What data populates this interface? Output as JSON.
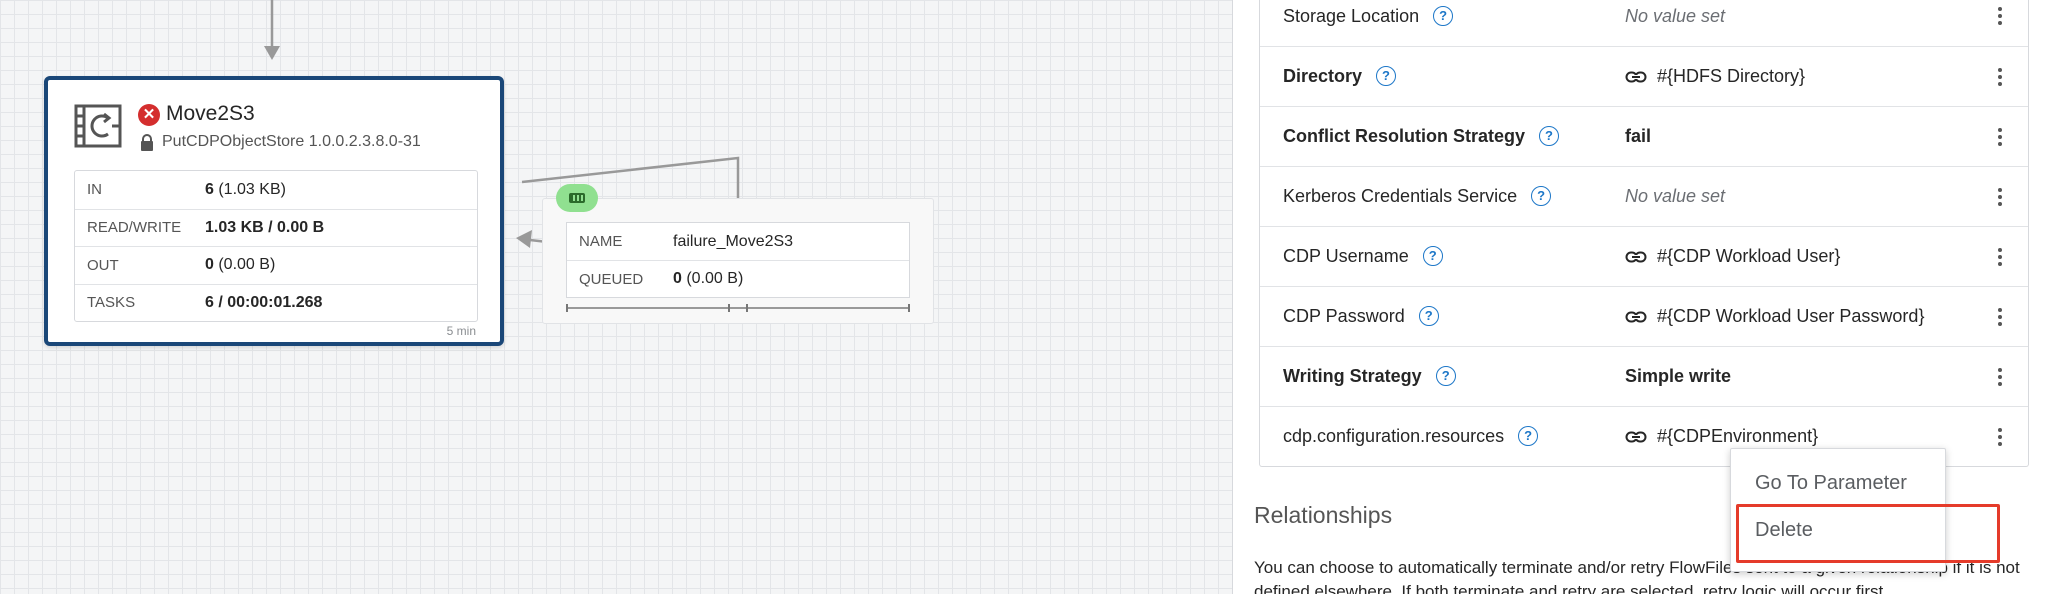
{
  "processor": {
    "name": "Move2S3",
    "type": "PutCDPObjectStore 1.0.0.2.3.8.0-31",
    "icon": "processor-icon",
    "status_icon": "error-icon",
    "status_color": "#d42e2e",
    "border_color": "#1a4778",
    "stats": [
      {
        "label": "IN",
        "bold": "6",
        "rest": " (1.03 KB)"
      },
      {
        "label": "READ/WRITE",
        "bold": "1.03 KB / 0.00 B",
        "rest": ""
      },
      {
        "label": "OUT",
        "bold": "0",
        "rest": " (0.00 B)"
      },
      {
        "label": "TASKS",
        "bold": "6 / 00:00:01.268",
        "rest": ""
      }
    ],
    "footer": "5 min"
  },
  "connection": {
    "badge_color": "#90e090",
    "rows": [
      {
        "label": "NAME",
        "value": "failure_Move2S3"
      },
      {
        "label": "QUEUED",
        "bold": "0",
        "rest": " (0.00 B)"
      }
    ]
  },
  "properties": [
    {
      "name": "Storage Location",
      "required": false,
      "value": "No value set",
      "empty": true,
      "param": false
    },
    {
      "name": "Directory",
      "required": true,
      "value": "#{HDFS Directory}",
      "empty": false,
      "param": true
    },
    {
      "name": "Conflict Resolution Strategy",
      "required": true,
      "value": "fail",
      "empty": false,
      "param": false
    },
    {
      "name": "Kerberos Credentials Service",
      "required": false,
      "value": "No value set",
      "empty": true,
      "param": false
    },
    {
      "name": "CDP Username",
      "required": false,
      "value": "#{CDP Workload User}",
      "empty": false,
      "param": true
    },
    {
      "name": "CDP Password",
      "required": false,
      "value": "#{CDP Workload User Password}",
      "empty": false,
      "param": true
    },
    {
      "name": "Writing Strategy",
      "required": true,
      "value": "Simple write",
      "empty": false,
      "param": false
    },
    {
      "name": "cdp.configuration.resources",
      "required": false,
      "value": "#{CDPEnvironment}",
      "empty": false,
      "param": true
    }
  ],
  "help_glyph": "?",
  "context_menu": {
    "go_to_parameter": "Go To Parameter",
    "delete": "Delete",
    "highlight_color": "#e53b2a"
  },
  "relationships": {
    "title": "Relationships",
    "description": "You can choose to automatically terminate and/or retry FlowFiles sent to a given relationship if it is not defined elsewhere. If both terminate and retry are selected, retry logic will occur first."
  }
}
